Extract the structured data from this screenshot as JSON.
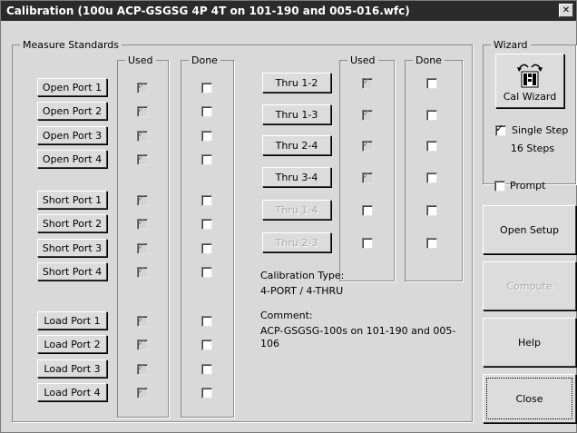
{
  "window": {
    "title": "Calibration (100u ACP-GSGSG 4P 4T on 101-190 and 005-016.wfc)",
    "close_glyph": "✕"
  },
  "measure": {
    "legend": "Measure Standards",
    "used_label": "Used",
    "done_label": "Done",
    "open": [
      {
        "label": "Open Port 1",
        "used": true,
        "done": false
      },
      {
        "label": "Open Port 2",
        "used": true,
        "done": false
      },
      {
        "label": "Open Port 3",
        "used": true,
        "done": false
      },
      {
        "label": "Open Port 4",
        "used": true,
        "done": false
      }
    ],
    "short": [
      {
        "label": "Short Port 1",
        "used": true,
        "done": false
      },
      {
        "label": "Short Port 2",
        "used": true,
        "done": false
      },
      {
        "label": "Short Port 3",
        "used": true,
        "done": false
      },
      {
        "label": "Short Port 4",
        "used": true,
        "done": false
      }
    ],
    "load": [
      {
        "label": "Load Port 1",
        "used": true,
        "done": false
      },
      {
        "label": "Load Port 2",
        "used": true,
        "done": false
      },
      {
        "label": "Load Port 3",
        "used": true,
        "done": false
      },
      {
        "label": "Load Port 4",
        "used": true,
        "done": false
      }
    ],
    "thru": [
      {
        "label": "Thru 1-2",
        "used": true,
        "done": false,
        "enabled": true
      },
      {
        "label": "Thru 1-3",
        "used": true,
        "done": false,
        "enabled": true
      },
      {
        "label": "Thru 2-4",
        "used": true,
        "done": false,
        "enabled": true
      },
      {
        "label": "Thru 3-4",
        "used": true,
        "done": false,
        "enabled": true
      },
      {
        "label": "Thru 1-4",
        "used": false,
        "done": false,
        "enabled": false
      },
      {
        "label": "Thru 2-3",
        "used": false,
        "done": false,
        "enabled": false
      }
    ],
    "cal_type_label": "Calibration Type:",
    "cal_type_value": "4-PORT / 4-THRU",
    "comment_label": "Comment:",
    "comment_value": "ACP-GSGSG-100s on 101-190 and 005-106"
  },
  "wizard": {
    "legend": "Wizard",
    "cal_wizard_label": "Cal Wizard",
    "single_step_label": "Single Step",
    "single_step_checked": true,
    "steps_text": "16 Steps"
  },
  "side": {
    "prompt_label": "Prompt",
    "prompt_checked": false,
    "open_setup": "Open Setup",
    "compute": "Compute",
    "help": "Help",
    "close": "Close"
  },
  "check_glyph": "✓"
}
